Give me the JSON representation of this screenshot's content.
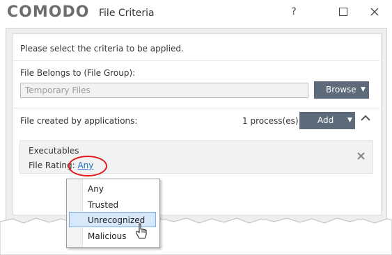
{
  "window": {
    "logo": "COMODO",
    "title": "File Criteria",
    "help_glyph": "?",
    "maximize_glyph": "☐",
    "close_glyph": "✕"
  },
  "instruction": "Please select the criteria to be applied.",
  "file_group": {
    "label": "File Belongs to (File Group):",
    "value": "Temporary Files",
    "browse_label": "Browse"
  },
  "created_by": {
    "label": "File created by applications:",
    "count": "1 process(es)",
    "add_label": "Add"
  },
  "executable": {
    "title": "Executables",
    "rating_label": "File Rating:",
    "rating_value": "Any"
  },
  "rating_menu": {
    "options": [
      "Any",
      "Trusted",
      "Unrecognized",
      "Malicious"
    ],
    "highlighted": "Unrecognized"
  },
  "colors": {
    "button": "#5c6a7a",
    "highlight_oval": "#e01b1b",
    "link": "#1e6fc5",
    "menu_hover": "#d7e8fb"
  },
  "icons": [
    "help-icon",
    "maximize-icon",
    "close-icon",
    "chevron-down-icon",
    "chevron-up-icon",
    "remove-icon",
    "hand-cursor-icon"
  ]
}
